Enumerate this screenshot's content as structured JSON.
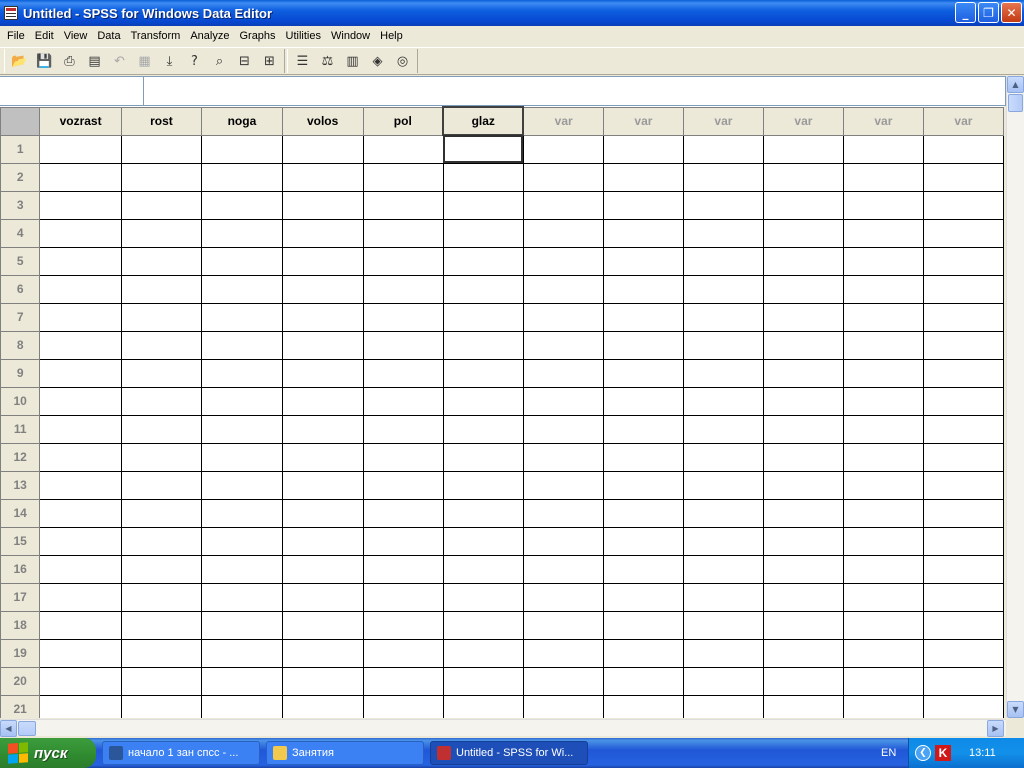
{
  "window": {
    "title": "Untitled - SPSS for Windows Data Editor",
    "minimize_glyph": "_",
    "maximize_glyph": "❐",
    "close_glyph": "✕"
  },
  "menu": [
    "File",
    "Edit",
    "View",
    "Data",
    "Transform",
    "Analyze",
    "Graphs",
    "Utilities",
    "Window",
    "Help"
  ],
  "toolbar": {
    "groups": [
      [
        {
          "icon": "open-folder-icon",
          "glyph": "📂"
        },
        {
          "icon": "save-disk-icon",
          "glyph": "💾"
        },
        {
          "icon": "print-icon",
          "glyph": "⎙"
        },
        {
          "icon": "dialog-recall-icon",
          "glyph": "▤"
        },
        {
          "icon": "undo-icon",
          "glyph": "↶",
          "disabled": true
        },
        {
          "icon": "goto-chart-icon",
          "glyph": "▦",
          "disabled": true
        },
        {
          "icon": "goto-case-icon",
          "glyph": "⤓"
        },
        {
          "icon": "variables-icon",
          "glyph": "?"
        },
        {
          "icon": "find-binoculars-icon",
          "glyph": "⌕"
        },
        {
          "icon": "insert-cases-icon",
          "glyph": "⊟"
        },
        {
          "icon": "insert-variable-icon",
          "glyph": "⊞"
        }
      ],
      [
        {
          "icon": "split-file-icon",
          "glyph": "☰"
        },
        {
          "icon": "weight-cases-icon",
          "glyph": "⚖"
        },
        {
          "icon": "select-cases-icon",
          "glyph": "▥"
        },
        {
          "icon": "value-labels-icon",
          "glyph": "◈"
        },
        {
          "icon": "use-sets-icon",
          "glyph": "◎"
        }
      ]
    ]
  },
  "grid": {
    "columns": [
      "vozrast",
      "rost",
      "noga",
      "volos",
      "pol",
      "glaz",
      "var",
      "var",
      "var",
      "var",
      "var",
      "var"
    ],
    "defined_count": 6,
    "selected_column": 5,
    "rows": [
      "1",
      "2",
      "3",
      "4",
      "5",
      "6",
      "7",
      "8",
      "9",
      "10",
      "11",
      "12",
      "13",
      "14",
      "15",
      "16",
      "17",
      "18",
      "19",
      "20",
      "21"
    ],
    "active_cell": {
      "row": 0,
      "col": 5
    }
  },
  "scrollbars": {
    "up": "▲",
    "down": "▼",
    "left": "◀",
    "right": "▶"
  },
  "taskbar": {
    "start_label": "пуск",
    "tasks": [
      {
        "label": "начало 1 зан спсс - ...",
        "icon": "word-doc-icon",
        "color": "#2b579a"
      },
      {
        "label": "Занятия",
        "icon": "folder-icon",
        "color": "#f2c94c"
      },
      {
        "label": "Untitled - SPSS for Wi...",
        "icon": "spss-icon",
        "color": "#c03030",
        "active": true
      }
    ],
    "language": "EN",
    "tray_arrow": "❮",
    "kaspersky_glyph": "K",
    "clock": "13:11"
  }
}
